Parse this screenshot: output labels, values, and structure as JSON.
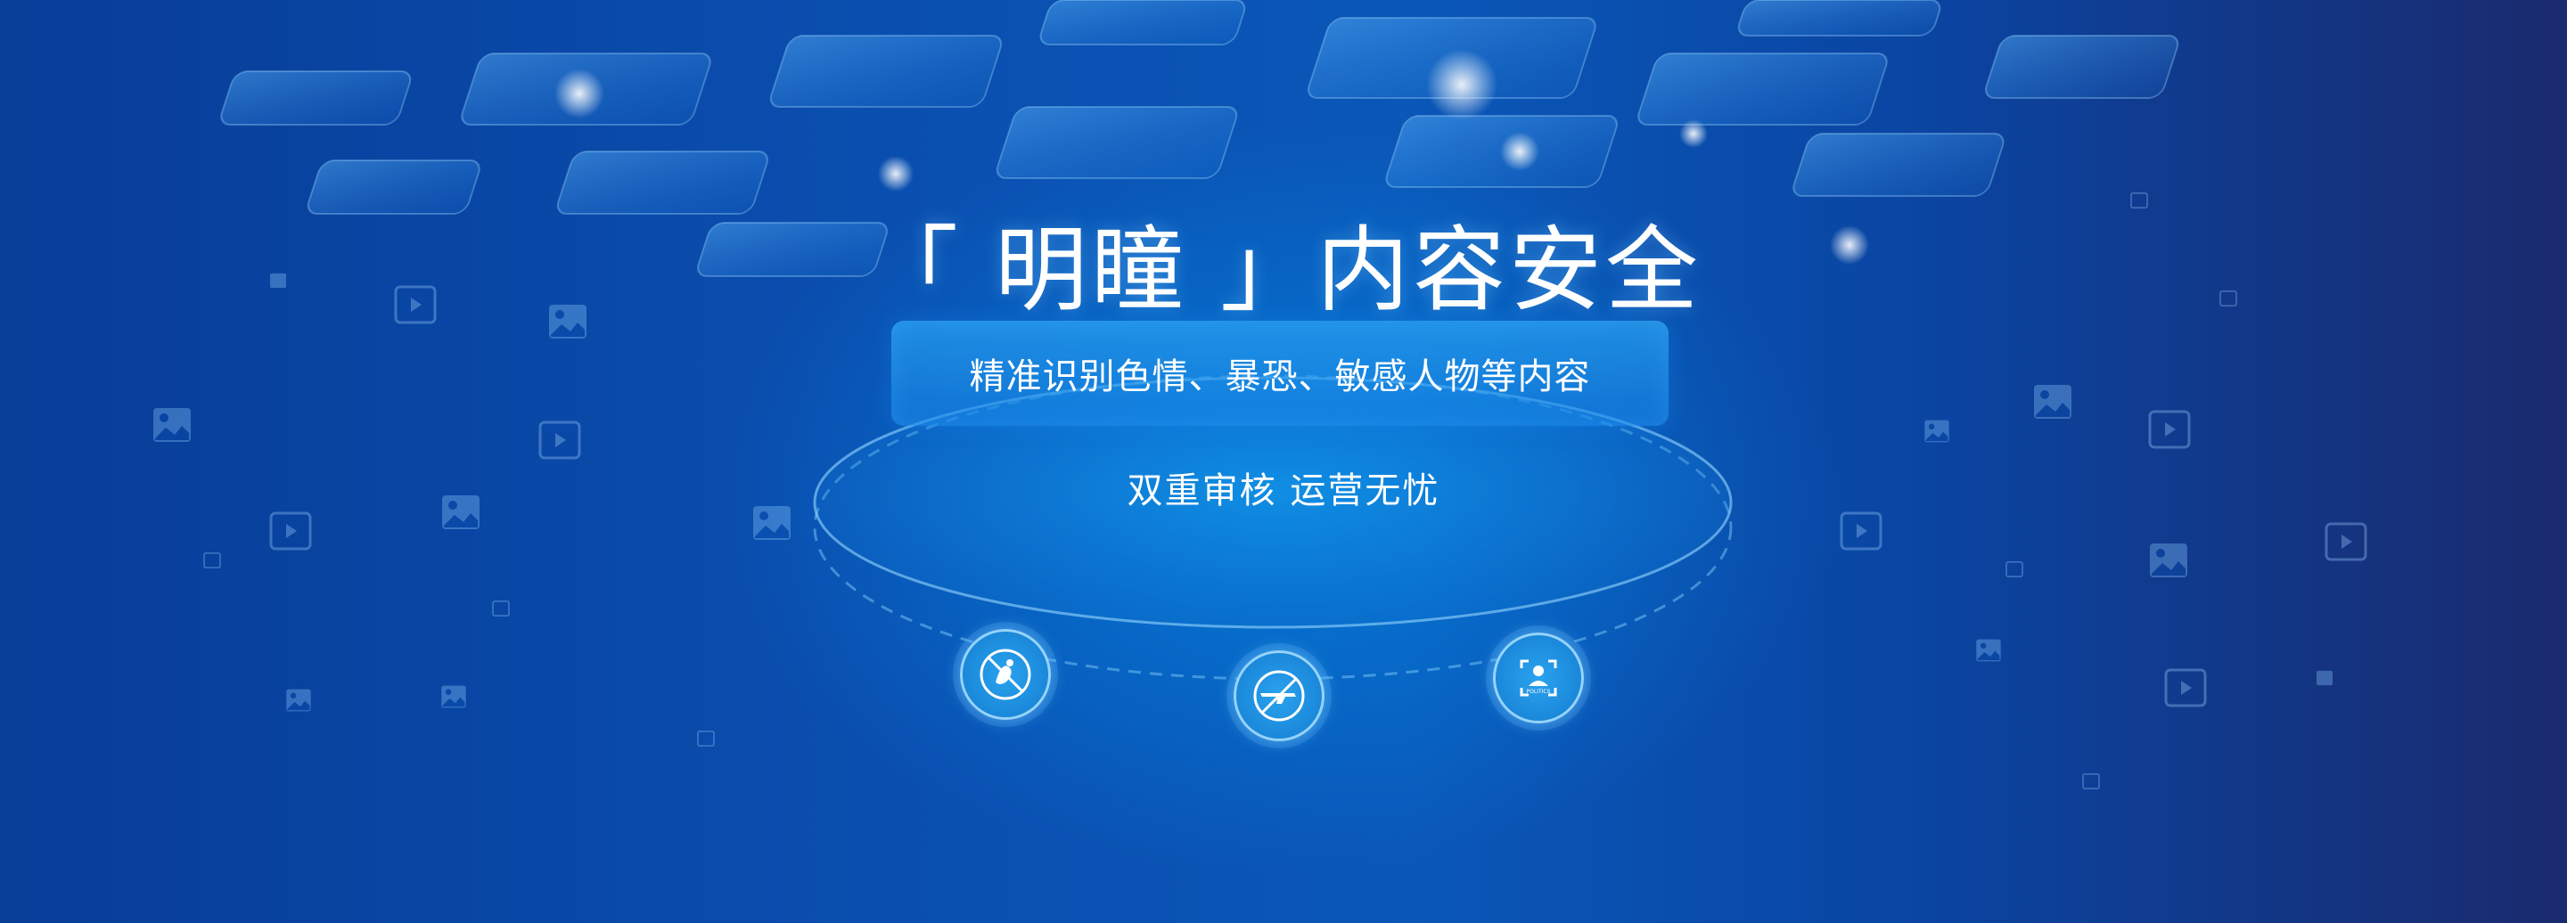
{
  "banner": {
    "title": "「 明瞳 」内容安全",
    "subtitle": "精准识别色情、暴恐、敏感人物等内容",
    "tagline": "双重审核 运营无忧"
  },
  "features": [
    {
      "name": "porn-filter",
      "icon": "no-porn-icon"
    },
    {
      "name": "terror-filter",
      "icon": "no-weapon-icon"
    },
    {
      "name": "politics-filter",
      "icon": "politics-person-icon",
      "label": "POLITICS"
    }
  ],
  "colors": {
    "background": "#0a4fb0",
    "accent": "#2aa3ee",
    "text": "#ffffff"
  }
}
